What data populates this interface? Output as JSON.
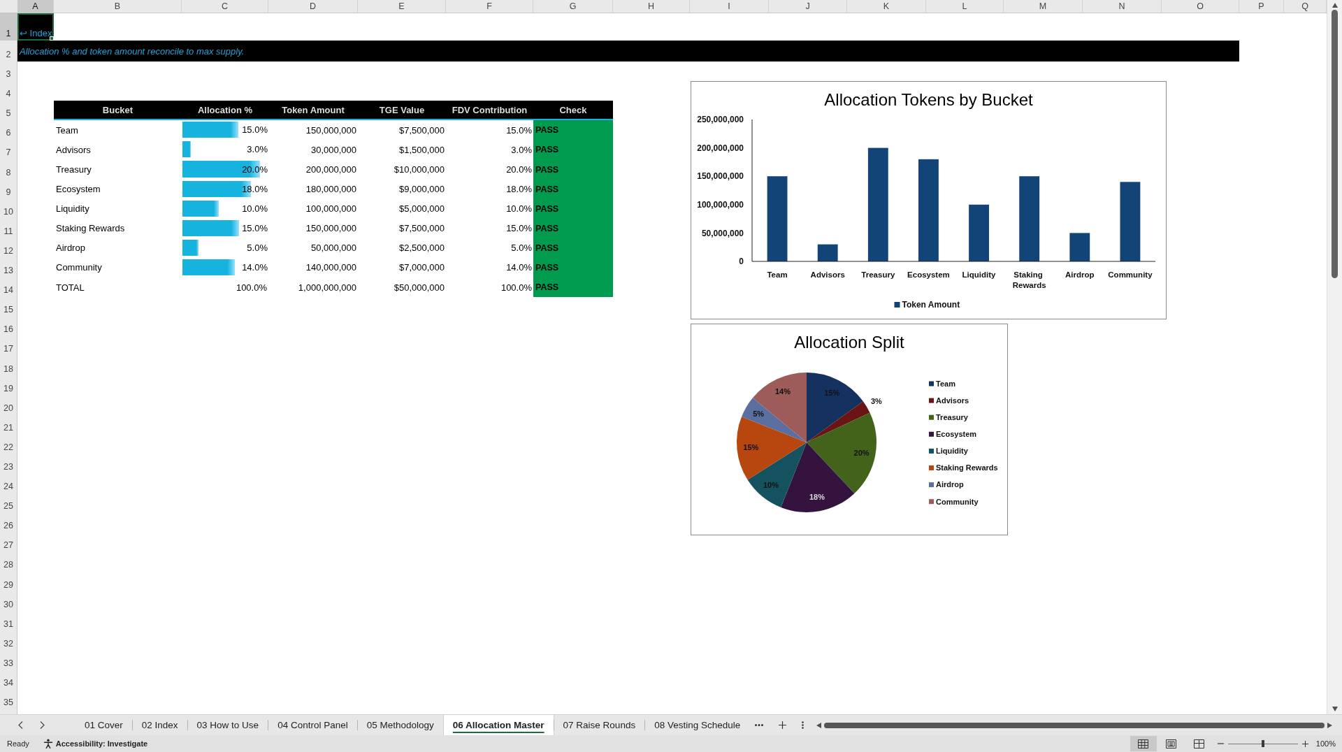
{
  "sheet": {
    "columns": [
      {
        "label": "A",
        "selected": true
      },
      {
        "label": "B",
        "selected": false
      },
      {
        "label": "C",
        "selected": false
      },
      {
        "label": "D",
        "selected": false
      },
      {
        "label": "E",
        "selected": false
      },
      {
        "label": "F",
        "selected": false
      },
      {
        "label": "G",
        "selected": false
      },
      {
        "label": "H",
        "selected": false
      },
      {
        "label": "I",
        "selected": false
      },
      {
        "label": "J",
        "selected": false
      },
      {
        "label": "K",
        "selected": false
      },
      {
        "label": "L",
        "selected": false
      },
      {
        "label": "M",
        "selected": false
      },
      {
        "label": "N",
        "selected": false
      },
      {
        "label": "O",
        "selected": false
      },
      {
        "label": "P",
        "selected": false
      },
      {
        "label": "Q",
        "selected": false
      }
    ],
    "rows": [
      {
        "label": "1",
        "selected": true
      },
      {
        "label": "2",
        "selected": false
      },
      {
        "label": "3",
        "selected": false
      },
      {
        "label": "4",
        "selected": false
      },
      {
        "label": "5",
        "selected": false
      },
      {
        "label": "6",
        "selected": false
      },
      {
        "label": "7",
        "selected": false
      },
      {
        "label": "8",
        "selected": false
      },
      {
        "label": "9",
        "selected": false
      },
      {
        "label": "10",
        "selected": false
      },
      {
        "label": "11",
        "selected": false
      },
      {
        "label": "12",
        "selected": false
      },
      {
        "label": "13",
        "selected": false
      },
      {
        "label": "14",
        "selected": false
      },
      {
        "label": "15",
        "selected": false
      },
      {
        "label": "16",
        "selected": false
      },
      {
        "label": "17",
        "selected": false
      },
      {
        "label": "18",
        "selected": false
      },
      {
        "label": "19",
        "selected": false
      },
      {
        "label": "20",
        "selected": false
      },
      {
        "label": "21",
        "selected": false
      },
      {
        "label": "22",
        "selected": false
      },
      {
        "label": "23",
        "selected": false
      },
      {
        "label": "24",
        "selected": false
      },
      {
        "label": "25",
        "selected": false
      },
      {
        "label": "26",
        "selected": false
      },
      {
        "label": "27",
        "selected": false
      },
      {
        "label": "28",
        "selected": false
      },
      {
        "label": "29",
        "selected": false
      },
      {
        "label": "30",
        "selected": false
      },
      {
        "label": "31",
        "selected": false
      },
      {
        "label": "32",
        "selected": false
      },
      {
        "label": "33",
        "selected": false
      },
      {
        "label": "34",
        "selected": false
      },
      {
        "label": "35",
        "selected": false
      }
    ],
    "index_link": "↩ Index",
    "note": "Allocation % and token amount reconcile to max supply."
  },
  "table": {
    "columns": [
      "Bucket",
      "Allocation %",
      "Token Amount",
      "TGE Value",
      "FDV Contribution",
      "Check"
    ],
    "rows": [
      {
        "bucket": "Team",
        "allocation": "15.0%",
        "level": 0.65,
        "token_amount": "150,000,000",
        "tge_value": "$7,500,000",
        "fdv_contribution": "15.0%",
        "check": "PASS",
        "passed": true
      },
      {
        "bucket": "Advisors",
        "allocation": "3.0%",
        "level": 0.1,
        "token_amount": "30,000,000",
        "tge_value": "$1,500,000",
        "fdv_contribution": "3.0%",
        "check": "PASS",
        "passed": true
      },
      {
        "bucket": "Treasury",
        "allocation": "20.0%",
        "level": 0.9,
        "token_amount": "200,000,000",
        "tge_value": "$10,000,000",
        "fdv_contribution": "20.0%",
        "check": "PASS",
        "passed": true
      },
      {
        "bucket": "Ecosystem",
        "allocation": "18.0%",
        "level": 0.8,
        "token_amount": "180,000,000",
        "tge_value": "$9,000,000",
        "fdv_contribution": "18.0%",
        "check": "PASS",
        "passed": true
      },
      {
        "bucket": "Liquidity",
        "allocation": "10.0%",
        "level": 0.42,
        "token_amount": "100,000,000",
        "tge_value": "$5,000,000",
        "fdv_contribution": "10.0%",
        "check": "PASS",
        "passed": true
      },
      {
        "bucket": "Staking Rewards",
        "allocation": "15.0%",
        "level": 0.66,
        "token_amount": "150,000,000",
        "tge_value": "$7,500,000",
        "fdv_contribution": "15.0%",
        "check": "PASS",
        "passed": true
      },
      {
        "bucket": "Airdrop",
        "allocation": "5.0%",
        "level": 0.19,
        "token_amount": "50,000,000",
        "tge_value": "$2,500,000",
        "fdv_contribution": "5.0%",
        "check": "PASS",
        "passed": true
      },
      {
        "bucket": "Community",
        "allocation": "14.0%",
        "level": 0.61,
        "token_amount": "140,000,000",
        "tge_value": "$7,000,000",
        "fdv_contribution": "14.0%",
        "check": "PASS",
        "passed": true
      }
    ],
    "total": {
      "bucket": "TOTAL",
      "allocation": "100.0%",
      "token_amount": "1,000,000,000",
      "tge_value": "$50,000,000",
      "fdv_contribution": "100.0%",
      "check": "PASS",
      "passed": true
    }
  },
  "charts": [
    {
      "chart_data": {
        "type": "bar",
        "title": "Allocation Tokens by Bucket",
        "categories": [
          "Team",
          "Advisors",
          "Treasury",
          "Ecosystem",
          "Liquidity",
          "Staking Rewards",
          "Airdrop",
          "Community"
        ],
        "series": [
          {
            "name": "Token Amount",
            "color": "#134478",
            "values": [
              150000000,
              30000000,
              200000000,
              180000000,
              100000000,
              150000000,
              50000000,
              140000000
            ]
          }
        ],
        "ylim": [
          0,
          250000000
        ],
        "yticks": [
          {
            "value": 0,
            "label": "0"
          },
          {
            "value": 50000000,
            "label": "50,000,000"
          },
          {
            "value": 100000000,
            "label": "100,000,000"
          },
          {
            "value": 150000000,
            "label": "150,000,000"
          },
          {
            "value": 200000000,
            "label": "200,000,000"
          },
          {
            "value": 250000000,
            "label": "250,000,000"
          }
        ],
        "legend": "bottom"
      }
    },
    {
      "chart_data": {
        "type": "pie",
        "title": "Allocation Split",
        "categories": [
          "Team",
          "Advisors",
          "Treasury",
          "Ecosystem",
          "Liquidity",
          "Staking Rewards",
          "Airdrop",
          "Community"
        ],
        "values": [
          15,
          3,
          20,
          18,
          10,
          15,
          5,
          14
        ],
        "colors": [
          "#15315f",
          "#6a1414",
          "#43621a",
          "#34143f",
          "#14525f",
          "#b8460f",
          "#5a6fa0",
          "#9d5b59"
        ],
        "value_labels": [
          "15%",
          "3%",
          "20%",
          "18%",
          "10%",
          "15%",
          "5%",
          "14%"
        ],
        "legend": "right"
      }
    }
  ],
  "sheet_tabs": [
    {
      "label": "01 Cover",
      "selected": false
    },
    {
      "label": "02 Index",
      "selected": false
    },
    {
      "label": "03 How to Use",
      "selected": false
    },
    {
      "label": "04 Control Panel",
      "selected": false
    },
    {
      "label": "05 Methodology",
      "selected": false
    },
    {
      "label": "06 Allocation Master",
      "selected": true
    },
    {
      "label": "07 Raise Rounds",
      "selected": false
    },
    {
      "label": "08 Vesting Schedule",
      "selected": false
    }
  ],
  "status_bar": {
    "status": "Ready",
    "accessibility": "Accessibility: Investigate",
    "views": [
      {
        "kind": "normal",
        "selected": true
      },
      {
        "kind": "page_layout",
        "selected": false
      },
      {
        "kind": "page_break",
        "selected": false
      }
    ],
    "zoom": {
      "level": 0.5,
      "reading": "100%"
    }
  }
}
